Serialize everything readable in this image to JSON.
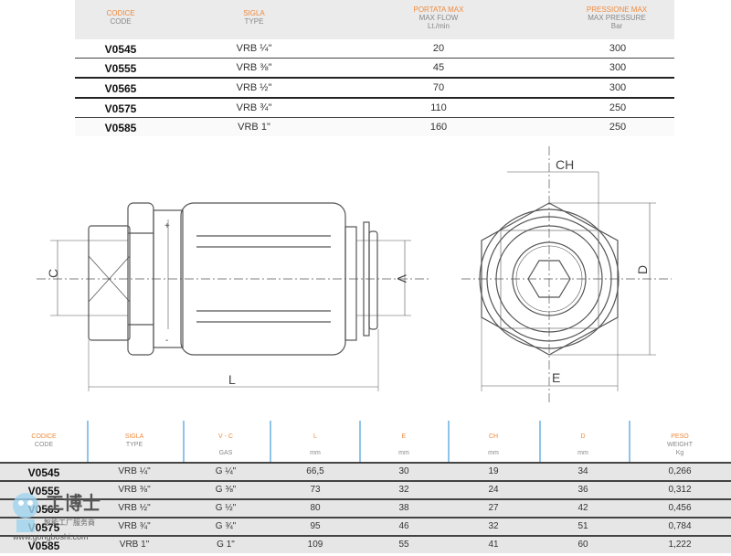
{
  "top_table": {
    "headers": [
      {
        "it": "CODICE",
        "en": "CODE",
        "unit": ""
      },
      {
        "it": "SIGLA",
        "en": "TYPE",
        "unit": ""
      },
      {
        "it": "PORTATA MAX",
        "en": "MAX FLOW",
        "unit": "Lt./min"
      },
      {
        "it": "PRESSIONE MAX",
        "en": "MAX PRESSURE",
        "unit": "Bar"
      }
    ],
    "rows": [
      [
        "V0545",
        "VRB ¼\"",
        "20",
        "300"
      ],
      [
        "V0555",
        "VRB ⅜\"",
        "45",
        "300"
      ],
      [
        "V0565",
        "VRB ½\"",
        "70",
        "300"
      ],
      [
        "V0575",
        "VRB ¾\"",
        "110",
        "250"
      ],
      [
        "V0585",
        "VRB 1\"",
        "160",
        "250"
      ]
    ]
  },
  "drawing": {
    "labels": {
      "C": "C",
      "V": "V",
      "L": "L",
      "CH": "CH",
      "D": "D",
      "E": "E",
      "plus": "+",
      "minus": "-"
    }
  },
  "bottom_table": {
    "headers": [
      {
        "it": "CODICE",
        "en": "CODE",
        "unit": ""
      },
      {
        "it": "SIGLA",
        "en": "TYPE",
        "unit": ""
      },
      {
        "it": "V - C",
        "en": "",
        "unit": "GAS"
      },
      {
        "it": "L",
        "en": "",
        "unit": "mm"
      },
      {
        "it": "E",
        "en": "",
        "unit": "mm"
      },
      {
        "it": "CH",
        "en": "",
        "unit": "mm"
      },
      {
        "it": "D",
        "en": "",
        "unit": "mm"
      },
      {
        "it": "PESO",
        "en": "WEIGHT",
        "unit": "Kg"
      }
    ],
    "rows": [
      [
        "V0545",
        "VRB ¼\"",
        "G ¼\"",
        "66,5",
        "30",
        "19",
        "34",
        "0,266"
      ],
      [
        "V0555",
        "VRB ⅜\"",
        "G ⅜\"",
        "73",
        "32",
        "24",
        "36",
        "0,312"
      ],
      [
        "V0565",
        "VRB ½\"",
        "G ½\"",
        "80",
        "38",
        "27",
        "42",
        "0,456"
      ],
      [
        "V0575",
        "VRB ¾\"",
        "G ¾\"",
        "95",
        "46",
        "32",
        "51",
        "0,784"
      ],
      [
        "V0585",
        "VRB 1\"",
        "G 1\"",
        "109",
        "55",
        "41",
        "60",
        "1,222"
      ]
    ]
  },
  "watermark": {
    "brand": "工博士",
    "tagline": "智能工厂服务商",
    "url": "www.gongboshi.com"
  },
  "colors": {
    "accent": "#f08a3c",
    "divider": "#8fc4ea"
  }
}
